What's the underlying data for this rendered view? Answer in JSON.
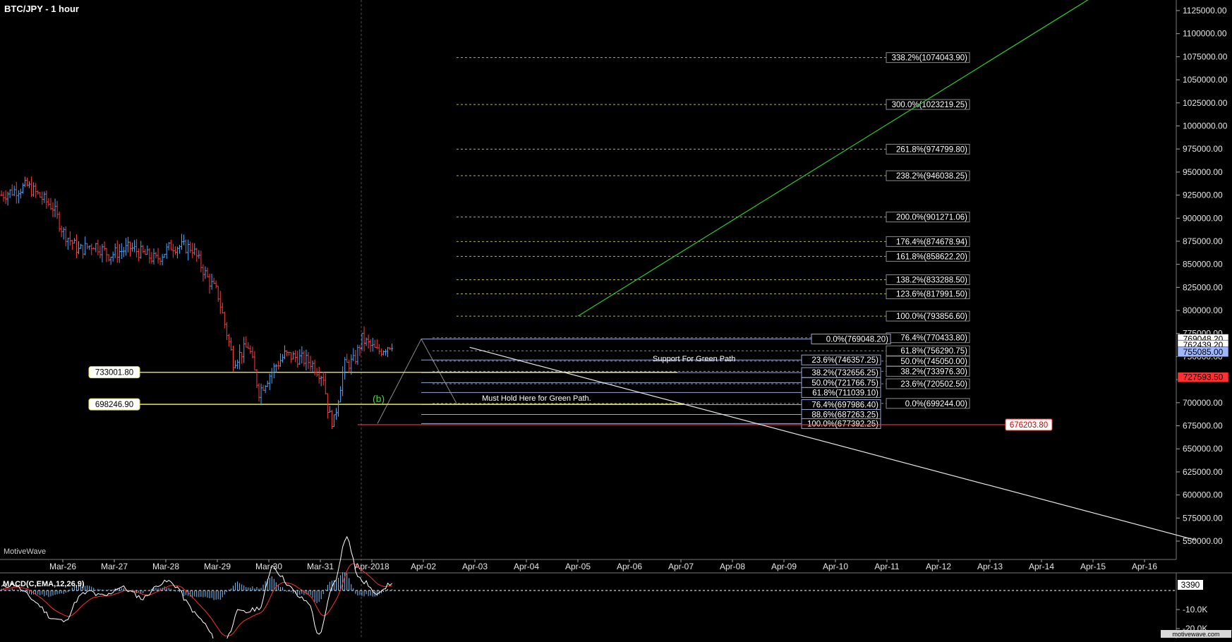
{
  "header": {
    "title": "BTC/JPY - 1 hour",
    "watermark": "MotiveWave",
    "site_badge": "motivewave.com"
  },
  "chart_data": [
    {
      "type": "candlestick",
      "title": "BTC/JPY - 1 hour",
      "ylim": [
        535000,
        1140000
      ],
      "y_ticks": [
        550000,
        575000,
        600000,
        625000,
        650000,
        675000,
        700000,
        725000,
        750000,
        775000,
        800000,
        825000,
        850000,
        875000,
        900000,
        925000,
        950000,
        975000,
        1000000,
        1025000,
        1050000,
        1075000,
        1100000,
        1125000
      ],
      "x_ticks": [
        "Mar-26",
        "Mar-27",
        "Mar-28",
        "Mar-29",
        "Mar-30",
        "Mar-31",
        "Apr-2018",
        "Apr-02",
        "Apr-03",
        "Apr-04",
        "Apr-05",
        "Apr-06",
        "Apr-07",
        "Apr-08",
        "Apr-09",
        "Apr-10",
        "Apr-11",
        "Apr-12",
        "Apr-13",
        "Apr-14",
        "Apr-15",
        "Apr-16"
      ],
      "price_path": [
        [
          0,
          925000
        ],
        [
          0.5,
          935000
        ],
        [
          1.0,
          912000
        ],
        [
          1.2,
          885000
        ],
        [
          1.5,
          865000
        ],
        [
          1.8,
          872000
        ],
        [
          2.1,
          860000
        ],
        [
          2.5,
          868000
        ],
        [
          3.0,
          855000
        ],
        [
          3.3,
          870000
        ],
        [
          3.7,
          868000
        ],
        [
          4.0,
          835000
        ],
        [
          4.2,
          818000
        ],
        [
          4.5,
          745000
        ],
        [
          4.8,
          762000
        ],
        [
          5.0,
          712000
        ],
        [
          5.3,
          738000
        ],
        [
          5.5,
          752000
        ],
        [
          5.8,
          748000
        ],
        [
          6.0,
          744000
        ],
        [
          6.25,
          728000
        ],
        [
          6.35,
          688000
        ],
        [
          6.45,
          677392
        ],
        [
          6.65,
          740000
        ],
        [
          6.85,
          745000
        ],
        [
          7.0,
          769048
        ],
        [
          7.3,
          755000
        ],
        [
          7.6,
          765000
        ]
      ],
      "fib_levels_right": [
        {
          "label": "338.2%(1074043.90)",
          "value": 1074043.9
        },
        {
          "label": "300.0%(1023219.25)",
          "value": 1023219.25
        },
        {
          "label": "261.8%(974799.80)",
          "value": 974799.8
        },
        {
          "label": "238.2%(946038.25)",
          "value": 946038.25
        },
        {
          "label": "200.0%(901271.06)",
          "value": 901271.06
        },
        {
          "label": "176.4%(874678.94)",
          "value": 874678.94
        },
        {
          "label": "161.8%(858622.20)",
          "value": 858622.2
        },
        {
          "label": "138.2%(833288.50)",
          "value": 833288.5
        },
        {
          "label": "123.6%(817991.50)",
          "value": 817991.5
        },
        {
          "label": "100.0%(793856.60)",
          "value": 793856.6
        },
        {
          "label": "76.4%(770433.80)",
          "value": 770433.8
        },
        {
          "label": "61.8%(756290.75)",
          "value": 756290.75
        },
        {
          "label": "50.0%(745050.00)",
          "value": 745050.0
        },
        {
          "label": "38.2%(733976.30)",
          "value": 733976.3
        },
        {
          "label": "23.6%(720502.50)",
          "value": 720502.5
        },
        {
          "label": "0.0%(699244.00)",
          "value": 699244.0
        }
      ],
      "fib_levels_retrace": [
        {
          "label": "0.0%(769048.20)",
          "value": 769048.2
        },
        {
          "label": "23.6%(746357.25)",
          "value": 746357.25
        },
        {
          "label": "38.2%(732656.25)",
          "value": 732656.25
        },
        {
          "label": "50.0%(721766.75)",
          "value": 721766.75
        },
        {
          "label": "61.8%(711039.10)",
          "value": 711039.1
        },
        {
          "label": "76.4%(697986.40)",
          "value": 697986.4
        },
        {
          "label": "88.6%(687263.25)",
          "value": 687263.25
        },
        {
          "label": "100.0%(677392.25)",
          "value": 677392.25
        }
      ],
      "horizontal_lines": [
        {
          "label": "733001.80",
          "value": 733001.8,
          "color": "#e8e84a"
        },
        {
          "label": "698246.90",
          "value": 698246.9,
          "color": "#e8e84a"
        },
        {
          "label": "676203.80",
          "value": 676203.8,
          "color": "#ff3030"
        }
      ],
      "price_markers": [
        {
          "label": "769048.20",
          "value": 769048.2,
          "color": "#ffffff"
        },
        {
          "label": "762439.20",
          "value": 762439.2,
          "color": "#ffffff"
        },
        {
          "label": "755085.00",
          "value": 755085.0,
          "color": "#9fb7ff"
        },
        {
          "label": "727593.50",
          "value": 727593.5,
          "color": "#ff3030"
        }
      ],
      "annotations": [
        {
          "text": "Support For Green Path",
          "value": 704000
        },
        {
          "text": "Must Hold Here for Green Path.",
          "value": 661000
        },
        {
          "text": "(b)",
          "value": 660000,
          "color": "#33dd33"
        }
      ],
      "trendlines": [
        {
          "name": "green-projection",
          "color": "#2ecc2e",
          "from": [
            10.0,
            793856.6
          ],
          "to": [
            20.0,
            1140000
          ]
        },
        {
          "name": "white-down-trend",
          "color": "#e6e6e6",
          "from": [
            7.9,
            760000
          ],
          "to": [
            22.0,
            551000
          ]
        }
      ]
    },
    {
      "type": "macd",
      "title": "MACD(C,EMA,12,26,9)",
      "value_label": "3390",
      "y_ticks": [
        -10000,
        -20000
      ],
      "y_tick_labels": [
        "-10.0K",
        "-20.0K"
      ]
    }
  ],
  "colors": {
    "background": "#000000",
    "up_bar": "#4aa8ff",
    "down_bar": "#ff3b3b",
    "fib": "#8fa0d0",
    "fib_ext": "#b6b646",
    "axis_text": "#e6e6e6"
  }
}
